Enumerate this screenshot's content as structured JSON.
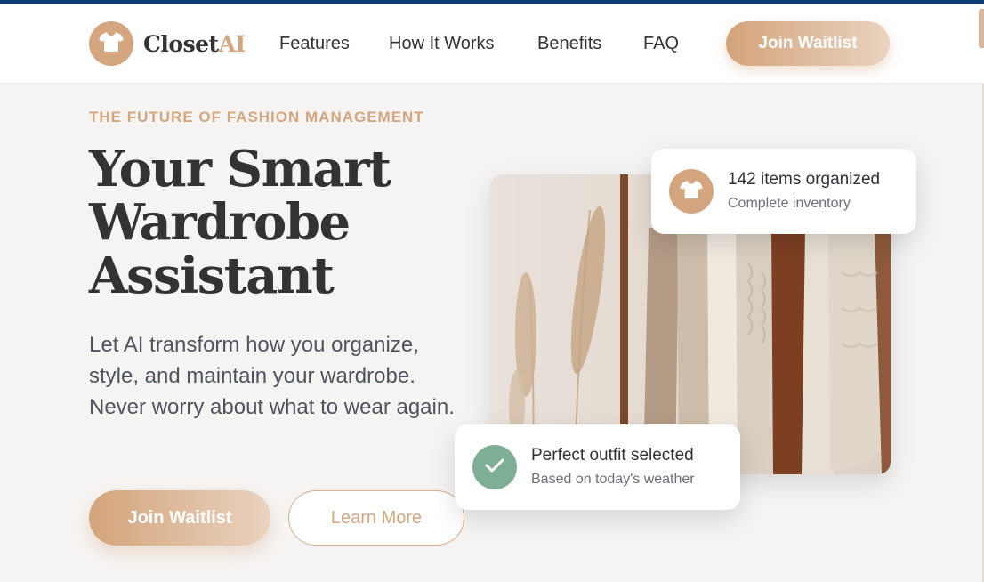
{
  "brand": {
    "name_main": "Closet",
    "name_accent": "AI",
    "accent_color": "#d4a67f",
    "dark_color": "#333333"
  },
  "nav": {
    "links": [
      "Features",
      "How It Works",
      "Benefits",
      "FAQ"
    ],
    "cta": "Join Waitlist"
  },
  "hero": {
    "eyebrow": "THE FUTURE OF FASHION MANAGEMENT",
    "title_lines": [
      "Your Smart",
      "Wardrobe",
      "Assistant"
    ],
    "subtitle": "Let AI transform how you organize, style, and maintain your wardrobe. Never worry about what to wear again.",
    "primary_button": "Join Waitlist",
    "secondary_button": "Learn More"
  },
  "cards": {
    "inventory": {
      "title": "142 items organized",
      "caption": "Complete inventory",
      "icon": "shirt-icon",
      "icon_color": "#d4a67f"
    },
    "outfit": {
      "title": "Perfect outfit selected",
      "caption": "Based on today's weather",
      "icon": "check-icon",
      "icon_color": "#7fae96"
    }
  }
}
